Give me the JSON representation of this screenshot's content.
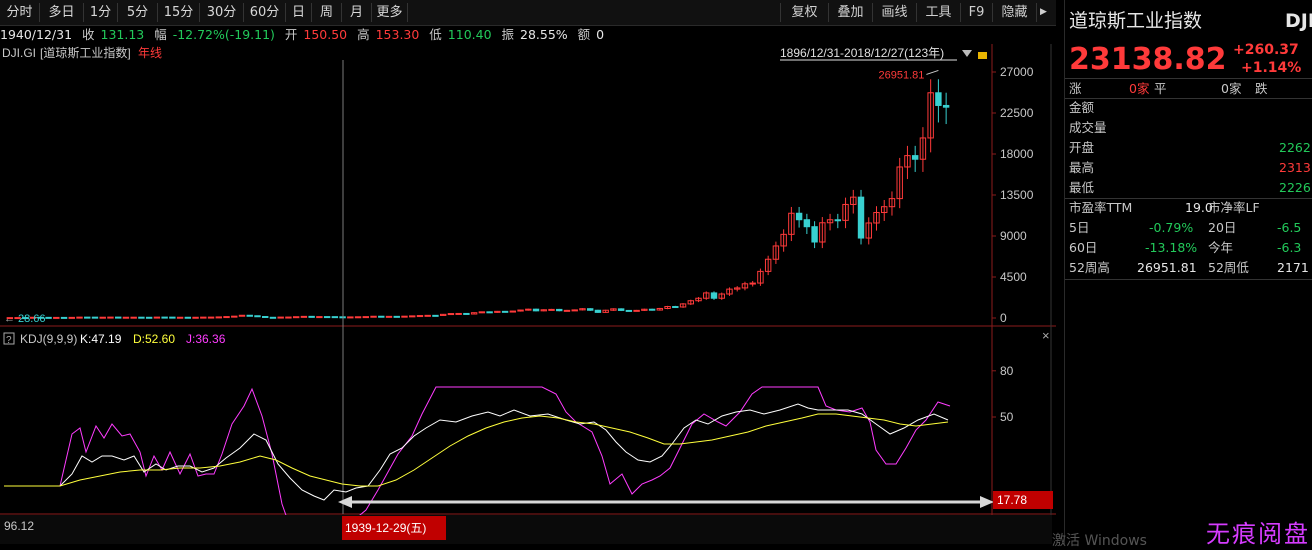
{
  "toolbar": {
    "periods": [
      "分时",
      "多日",
      "1分",
      "5分",
      "15分",
      "30分",
      "60分",
      "日",
      "周",
      "月",
      "更多"
    ],
    "tools": [
      "复权",
      "叠加",
      "画线",
      "工具",
      "F9",
      "隐藏"
    ]
  },
  "info": {
    "date": "1940/12/31",
    "close_label": "收",
    "close": "131.13",
    "change_label": "幅",
    "change": "-12.72%(-19.11)",
    "open_label": "开",
    "open": "150.50",
    "high_label": "高",
    "high": "153.30",
    "low_label": "低",
    "low": "110.40",
    "amp_label": "振",
    "amp": "28.55%",
    "amount_label": "额",
    "amount": "0"
  },
  "main_chart": {
    "symbol": "DJI.GI",
    "name": "[道琼斯工业指数]",
    "period_tag": "年线",
    "range_text": "1896/12/31-2018/12/27(123年)",
    "y_ticks": [
      "27000",
      "22500",
      "18000",
      "13500",
      "9000",
      "4500",
      "0"
    ],
    "max_label": "26951.81",
    "min_label": "28.66"
  },
  "kdj": {
    "title": "KDJ(9,9,9)",
    "k_label": "K:47.19",
    "d_label": "D:52.60",
    "j_label": "J:36.36",
    "y_ticks": [
      "80",
      "50"
    ],
    "cursor_value": "17.78",
    "help_label": "?",
    "close_label": "×"
  },
  "bottom": {
    "left_value": "96.12",
    "cursor_date": "1939-12-29(五)"
  },
  "quote": {
    "name": "道琼斯工业指数",
    "code": "DJI",
    "price": "23138.82",
    "change": "+260.37",
    "change_pct": "+1.14%",
    "up_label": "涨",
    "up_count": "0家",
    "flat_label": "平",
    "down_count": "0家",
    "down_label": "跌",
    "amount_label": "金额",
    "volume_label": "成交量",
    "open_label": "开盘",
    "open": "2262",
    "high_label": "最高",
    "high": "2313",
    "low_label": "最低",
    "low": "2226",
    "pe_label": "市盈率TTM",
    "pe": "19.0",
    "pb_label": "市净率LF",
    "d5_label": "5日",
    "d5": "-0.79%",
    "d20_label": "20日",
    "d20": "-6.5",
    "d60_label": "60日",
    "d60": "-13.18%",
    "ytd_label": "今年",
    "ytd": "-6.3",
    "w52h_label": "52周高",
    "w52h": "26951.81",
    "w52l_label": "52周低",
    "w52l": "2171"
  },
  "watermark": "无痕阅盘",
  "os_overlay": "激活 Windows",
  "colors": {
    "up": "#ff3a3a",
    "down": "#38d0d0",
    "k": "#ffffff",
    "d": "#ffff3c",
    "j": "#ff3cff"
  },
  "chart_data": [
    {
      "type": "candlestick",
      "title": "DJI.GI 年线",
      "ylim": [
        0,
        27000
      ],
      "close_values": [
        41,
        47,
        38,
        80,
        70,
        64,
        65,
        49,
        69,
        96,
        94,
        59,
        86,
        99,
        81,
        85,
        88,
        79,
        54,
        99,
        95,
        74,
        82,
        71,
        81,
        96,
        99,
        120,
        157,
        202,
        300,
        248,
        164,
        78,
        60,
        100,
        104,
        144,
        180,
        120,
        155,
        150,
        131,
        111,
        119,
        135,
        152,
        193,
        177,
        181,
        177,
        200,
        235,
        269,
        291,
        280,
        404,
        488,
        499,
        436,
        583,
        679,
        616,
        731,
        652,
        762,
        874,
        969,
        785,
        905,
        943,
        800,
        839,
        890,
        1020,
        851,
        616,
        852,
        1005,
        831,
        805,
        838,
        964,
        875,
        1046,
        1259,
        1211,
        1547,
        1896,
        2168,
        2753,
        2169,
        2633,
        3169,
        3301,
        3754,
        3834,
        5117,
        6448,
        7908,
        9181,
        11497,
        10787,
        10021,
        8341,
        10453,
        10783,
        10717,
        12463,
        13264,
        8776,
        10428,
        11577,
        12217,
        13104,
        16576,
        17823,
        17425,
        19762,
        24719,
        23327,
        23138
      ],
      "max": 26951.81,
      "min": 28.66
    },
    {
      "type": "line",
      "title": "KDJ(9,9,9)",
      "ylim": [
        0,
        100
      ],
      "series": [
        {
          "name": "K",
          "last": 47.19
        },
        {
          "name": "D",
          "last": 52.6
        },
        {
          "name": "J",
          "last": 36.36
        }
      ]
    }
  ]
}
